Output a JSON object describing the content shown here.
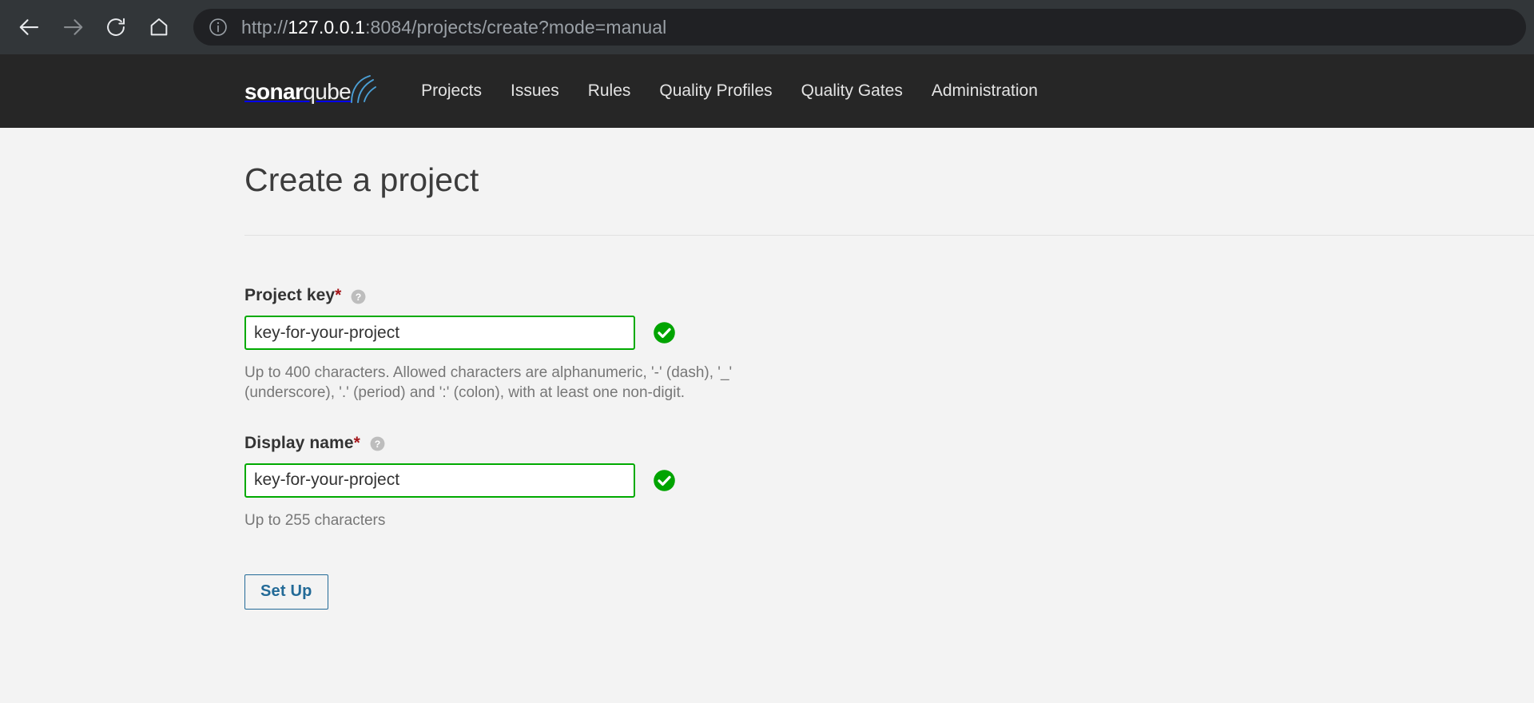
{
  "browser": {
    "back_icon": "arrow-left-icon",
    "forward_icon": "arrow-right-icon",
    "reload_icon": "reload-icon",
    "home_icon": "home-icon",
    "info_icon": "info-circle-icon",
    "url_scheme": "http://",
    "url_host": "127.0.0.1",
    "url_rest": ":8084/projects/create?mode=manual",
    "url_full": "http://127.0.0.1:8084/projects/create?mode=manual"
  },
  "navbar": {
    "logo_bold": "sonar",
    "logo_light": "qube",
    "items": [
      {
        "label": "Projects"
      },
      {
        "label": "Issues"
      },
      {
        "label": "Rules"
      },
      {
        "label": "Quality Profiles"
      },
      {
        "label": "Quality Gates"
      },
      {
        "label": "Administration"
      }
    ]
  },
  "main": {
    "title": "Create a project",
    "fields": [
      {
        "label": "Project key",
        "required_marker": "*",
        "value": "key-for-your-project",
        "hint": "Up to 400 characters. Allowed characters are alphanumeric, '-' (dash), '_' (underscore), '.' (period) and ':' (colon), with at least one non-digit.",
        "valid": true
      },
      {
        "label": "Display name",
        "required_marker": "*",
        "value": "key-for-your-project",
        "hint": "Up to 255 characters",
        "valid": true
      }
    ],
    "submit_label": "Set Up"
  },
  "colors": {
    "browser_chrome": "#323639",
    "omnibox": "#202124",
    "navbar": "#262626",
    "page_bg": "#f3f3f3",
    "valid_green": "#00aa00",
    "required_red": "#a4161a",
    "link_blue": "#236a97",
    "logo_arc_blue": "#4b9fd5"
  }
}
